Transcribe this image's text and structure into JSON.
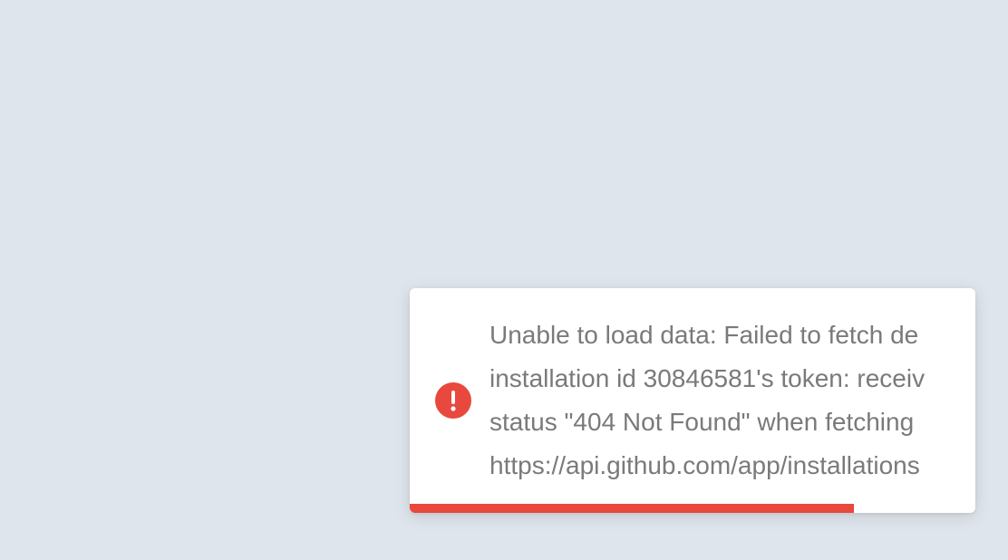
{
  "toast": {
    "type": "error",
    "icon": "exclamation-circle-icon",
    "message_lines": [
      "Unable to load data: Failed to fetch de",
      "installation id 30846581's token: receiv",
      "status \"404 Not Found\" when fetching",
      "https://api.github.com/app/installations"
    ],
    "progress_fraction": 0.785,
    "accent_color": "#e8483d",
    "text_color": "#7a7a7a"
  }
}
